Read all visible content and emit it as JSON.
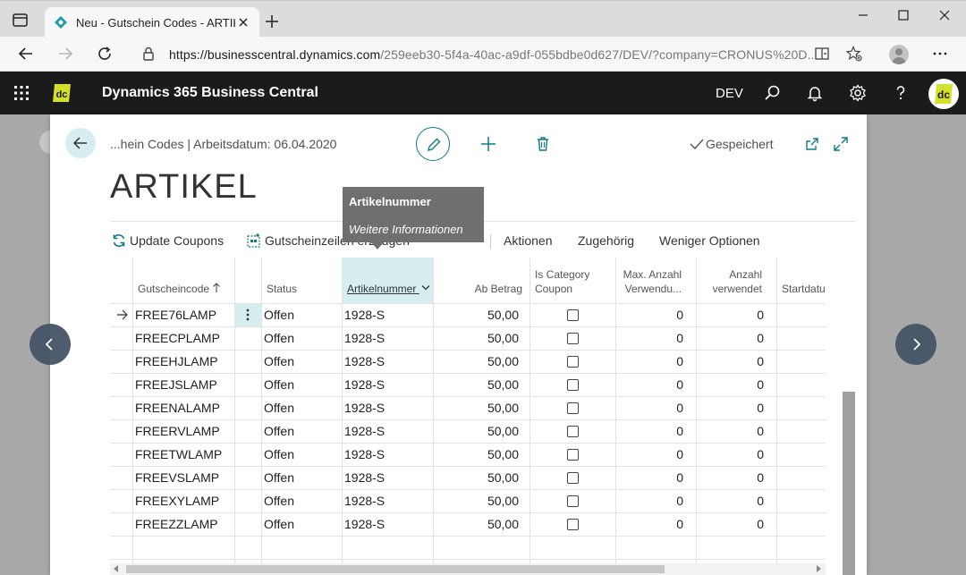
{
  "browser": {
    "tab_title": "Neu - Gutschein Codes - ARTIKEL",
    "url_host": "https://businesscentral.dynamics.com",
    "url_path": "/259eeb30-5f4a-40ac-a9df-055bdbe0d627/DEV/?company=CRONUS%20D..."
  },
  "app": {
    "title": "Dynamics 365 Business Central",
    "environment": "DEV",
    "logo_text": "dc",
    "brand_color": "#d4e02c"
  },
  "page": {
    "breadcrumb": "...hein Codes | Arbeitsdatum: 06.04.2020",
    "saved_label": "Gespeichert",
    "title": "ARTIKEL"
  },
  "actions": {
    "update_coupons": "Update Coupons",
    "generate_lines": "Gutscheinzeilen erzeugen",
    "aktionen": "Aktionen",
    "zugehoerig": "Zugehörig",
    "weniger_optionen": "Weniger Optionen"
  },
  "tooltip": {
    "title": "Artikelnummer",
    "more_info": "Weitere Informationen"
  },
  "grid": {
    "columns": {
      "code": "Gutscheincode",
      "status": "Status",
      "item_no": "Artikelnummer",
      "ab_betrag": "Ab Betrag",
      "is_category_1": "Is Category",
      "is_category_2": "Coupon",
      "max_anzahl_1": "Max. Anzahl",
      "max_anzahl_2": "Verwendu...",
      "anzahl_1": "Anzahl",
      "anzahl_2": "verwendet",
      "startdatum": "Startdatu"
    },
    "rows": [
      {
        "code": "FREE76LAMP",
        "status": "Offen",
        "item": "1928-S",
        "amount": "50,00",
        "max": "0",
        "used": "0"
      },
      {
        "code": "FREECPLAMP",
        "status": "Offen",
        "item": "1928-S",
        "amount": "50,00",
        "max": "0",
        "used": "0"
      },
      {
        "code": "FREEHJLAMP",
        "status": "Offen",
        "item": "1928-S",
        "amount": "50,00",
        "max": "0",
        "used": "0"
      },
      {
        "code": "FREEJSLAMP",
        "status": "Offen",
        "item": "1928-S",
        "amount": "50,00",
        "max": "0",
        "used": "0"
      },
      {
        "code": "FREENALAMP",
        "status": "Offen",
        "item": "1928-S",
        "amount": "50,00",
        "max": "0",
        "used": "0"
      },
      {
        "code": "FREERVLAMP",
        "status": "Offen",
        "item": "1928-S",
        "amount": "50,00",
        "max": "0",
        "used": "0"
      },
      {
        "code": "FREETWLAMP",
        "status": "Offen",
        "item": "1928-S",
        "amount": "50,00",
        "max": "0",
        "used": "0"
      },
      {
        "code": "FREEVSLAMP",
        "status": "Offen",
        "item": "1928-S",
        "amount": "50,00",
        "max": "0",
        "used": "0"
      },
      {
        "code": "FREEXYLAMP",
        "status": "Offen",
        "item": "1928-S",
        "amount": "50,00",
        "max": "0",
        "used": "0"
      },
      {
        "code": "FREEZZLAMP",
        "status": "Offen",
        "item": "1928-S",
        "amount": "50,00",
        "max": "0",
        "used": "0"
      }
    ]
  },
  "icons": [
    "tab-actions-icon",
    "favicon-icon",
    "close-icon",
    "new-tab-icon",
    "minimize-icon",
    "maximize-icon",
    "back-icon",
    "forward-icon",
    "refresh-icon",
    "lock-icon",
    "split-screen-icon",
    "favorites-icon",
    "more-icon",
    "waffle-icon",
    "search-icon",
    "bell-icon",
    "gear-icon",
    "help-icon",
    "edit-icon",
    "add-icon",
    "delete-icon",
    "check-icon",
    "share-icon",
    "expand-icon",
    "refresh-coupons-icon",
    "generate-lines-icon",
    "sort-up-icon",
    "chevron-down-icon",
    "row-selected-arrow-icon",
    "row-menu-icon",
    "chevron-left-icon",
    "chevron-right-icon"
  ]
}
